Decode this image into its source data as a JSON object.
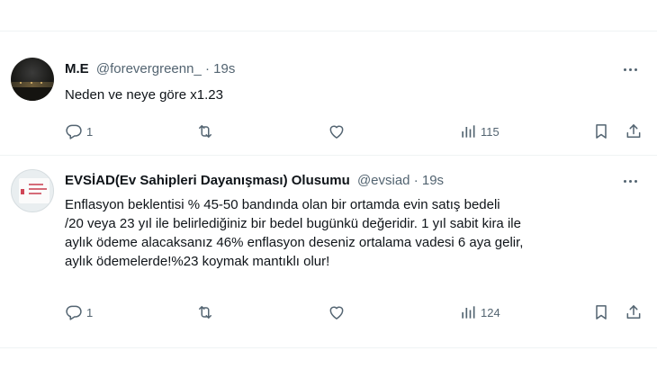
{
  "tweets": [
    {
      "name": "M.E",
      "handle": "@forevergreenn_",
      "separator": "·",
      "time": "19s",
      "text": "Neden ve neye göre x1.23",
      "replies": "1",
      "views": "115",
      "avatar_icon": "night-landscape-avatar"
    },
    {
      "name": "EVSİAD(Ev Sahipleri Dayanışması) Olusumu",
      "handle": "@evsiad",
      "separator": "·",
      "time": "19s",
      "text": "Enflasyon beklentisi % 45-50 bandında olan bir ortamda evin satış bedeli\n/20 veya 23 yıl ile belirlediğiniz bir bedel bugünkü değeridir. 1 yıl sabit kira ile\naylık ödeme alacaksanız 46% enflasyon deseniz ortalama vadesi 6 aya gelir,\naylık ödemelerde!%23 koymak mantıklı olur!",
      "replies": "1",
      "views": "124",
      "avatar_icon": "document-card-avatar"
    }
  ],
  "colors": {
    "text": "#0f1419",
    "secondary": "#536471",
    "border": "#eff3f4"
  },
  "icons": [
    "reply-icon",
    "retweet-icon",
    "like-icon",
    "views-icon",
    "bookmark-icon",
    "share-icon",
    "more-icon"
  ]
}
